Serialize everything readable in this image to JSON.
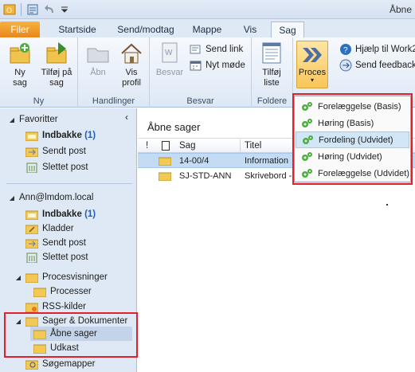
{
  "window": {
    "title": "Åbne"
  },
  "qat": {
    "icons": [
      "outlook-icon",
      "send-receive-icon",
      "undo-icon",
      "customize-icon"
    ]
  },
  "tabs": [
    {
      "label": "Filer"
    },
    {
      "label": "Startside"
    },
    {
      "label": "Send/modtag"
    },
    {
      "label": "Mappe"
    },
    {
      "label": "Vis"
    },
    {
      "label": "Sag"
    }
  ],
  "ribbon": {
    "groups": {
      "ny": {
        "label": "Ny",
        "new_case": "Ny\nsag",
        "add_to_case": "Tilføj på\nsag"
      },
      "handlinger": {
        "label": "Handlinger",
        "open": "Åbn",
        "show_profile": "Vis\nprofil"
      },
      "besvar": {
        "label": "Besvar",
        "reply": "Besvar",
        "send_link": "Send link",
        "new_meeting": "Nyt møde"
      },
      "foldere": {
        "label": "Foldere",
        "add_list": "Tilføj\nliste"
      },
      "proces": {
        "label": "Proces"
      },
      "help": {
        "help_label": "Hjælp til Work2",
        "feedback_label": "Send feedback"
      }
    }
  },
  "sidebar": {
    "favorites": {
      "title": "Favoritter",
      "items": [
        {
          "label": "Indbakke",
          "count": "(1)"
        },
        {
          "label": "Sendt post"
        },
        {
          "label": "Slettet post"
        }
      ]
    },
    "account": {
      "title": "Ann@lmdom.local",
      "items": [
        {
          "label": "Indbakke",
          "count": "(1)"
        },
        {
          "label": "Kladder"
        },
        {
          "label": "Sendt post"
        },
        {
          "label": "Slettet post"
        }
      ]
    },
    "process": {
      "title": "Procesvisninger",
      "child": "Processer"
    },
    "rss": "RSS-kilder",
    "cases": {
      "title": "Sager & Dokumenter",
      "children": [
        "Åbne sager",
        "Udkast"
      ]
    },
    "search": "Søgemapper"
  },
  "main": {
    "title": "Åbne sager",
    "columns": {
      "sag": "Sag",
      "titel": "Titel"
    },
    "rows": [
      {
        "sag": "14-00/4",
        "titel": "Information"
      },
      {
        "sag": "SJ-STD-ANN",
        "titel": "Skrivebord -"
      }
    ]
  },
  "proces_menu": {
    "items": [
      {
        "label": "Forelæggelse (Basis)"
      },
      {
        "label": "Høring (Basis)"
      },
      {
        "label": "Fordeling (Udvidet)"
      },
      {
        "label": "Høring (Udvidet)"
      },
      {
        "label": "Forelæggelse (Udvidet)"
      }
    ]
  },
  "colors": {
    "accent": "#f5a623",
    "highlight": "#d1e6f7",
    "red_box": "#e0202a"
  }
}
